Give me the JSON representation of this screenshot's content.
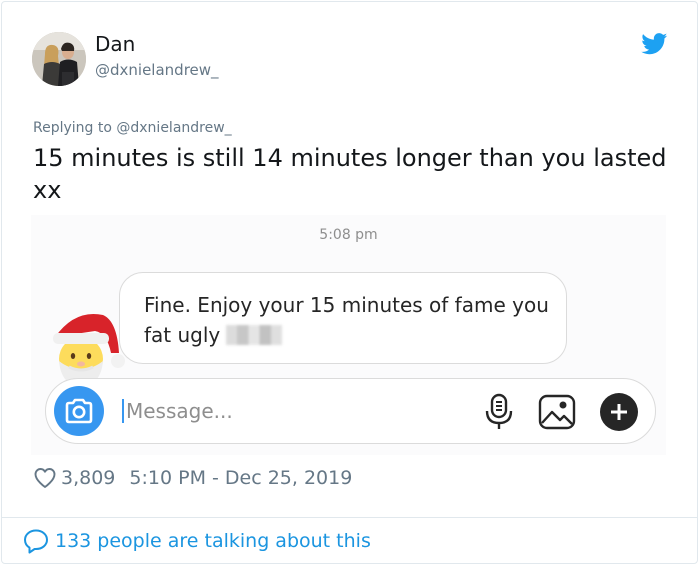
{
  "tweet": {
    "user_name": "Dan",
    "user_handle": "@dxnielandrew_",
    "replying_to": "Replying to @dxnielandrew_",
    "text": "15 minutes is still 14 minutes longer than you lasted xx",
    "likes": "3,809",
    "timestamp": "5:10 PM - Dec 25, 2019",
    "talking": "133 people are talking about this"
  },
  "dm": {
    "time": "5:08 pm",
    "message": "Fine. Enjoy your 15 minutes of fame you fat ugly",
    "input_placeholder": "Message..."
  },
  "icons": {
    "brand": "twitter-bird-icon",
    "like": "heart-icon",
    "reply": "speech-bubble-icon",
    "camera": "camera-icon",
    "mic": "microphone-icon",
    "photo": "image-icon",
    "add": "plus-icon",
    "avatar_emoji": "santa-claus-emoji"
  },
  "colors": {
    "twitter_blue": "#1da1f2",
    "link_blue": "#1b95e0",
    "secondary_text": "#657786",
    "instagram_blue": "#3797f0"
  }
}
